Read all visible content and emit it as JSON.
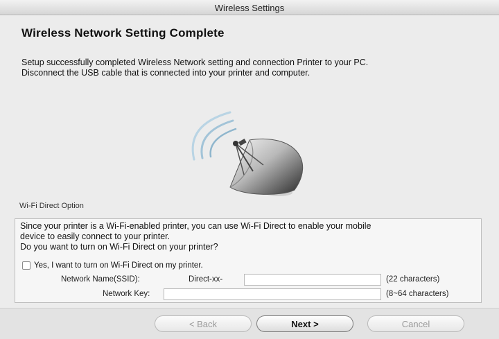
{
  "window": {
    "title": "Wireless Settings"
  },
  "main": {
    "heading": "Wireless Network Setting Complete",
    "description_line1": "Setup successfully completed Wireless Network setting and connection Printer to your PC.",
    "description_line2": "Disconnect the USB cable that is connected into your printer and computer."
  },
  "wifi_direct": {
    "group_label": "Wi-Fi Direct Option",
    "text_line1": "Since your printer is a Wi-Fi-enabled printer, you can use Wi-Fi Direct to enable your mobile",
    "text_line2": "device to easily connect to your printer.",
    "text_line3": "Do you want to turn on Wi-Fi Direct on your printer?",
    "checkbox_label": "Yes, I want to turn on Wi-Fi Direct on my printer.",
    "checkbox_checked": false,
    "ssid_label": "Network Name(SSID):",
    "ssid_prefix": "Direct-xx-",
    "ssid_value": "",
    "ssid_hint": "(22 characters)",
    "key_label": "Network Key:",
    "key_value": "",
    "key_hint": "(8~64 characters)"
  },
  "buttons": {
    "back": "< Back",
    "next": "Next >",
    "cancel": "Cancel"
  },
  "icons": {
    "illustration": "satellite-dish-icon"
  },
  "colors": {
    "background": "#ececec",
    "footer": "#e3e3e3",
    "dish": "#3a3a3a",
    "wave": "#a9c8dc"
  }
}
